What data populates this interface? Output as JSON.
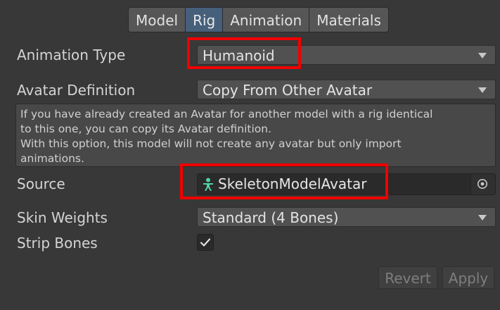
{
  "tabs": [
    {
      "label": "Model"
    },
    {
      "label": "Rig",
      "active": true
    },
    {
      "label": "Animation"
    },
    {
      "label": "Materials"
    }
  ],
  "animation_type": {
    "label": "Animation Type",
    "value": "Humanoid"
  },
  "avatar_definition": {
    "label": "Avatar Definition",
    "value": "Copy From Other Avatar"
  },
  "help_text": {
    "line1": "If you have already created an Avatar for another model with a rig identical",
    "line2": "to this one, you can copy its Avatar definition.",
    "line3": "With this option, this model will not create any avatar but only import",
    "line4": "animations."
  },
  "source": {
    "label": "Source",
    "value": "SkeletonModelAvatar",
    "icon": "avatar-icon"
  },
  "skin_weights": {
    "label": "Skin Weights",
    "value": "Standard (4 Bones)"
  },
  "strip_bones": {
    "label": "Strip Bones",
    "checked": true
  },
  "buttons": {
    "revert": "Revert",
    "apply": "Apply"
  },
  "colors": {
    "background": "#383838",
    "active_tab": "#46607c",
    "highlight": "#f00000",
    "avatar_icon": "#4fd1a6"
  }
}
